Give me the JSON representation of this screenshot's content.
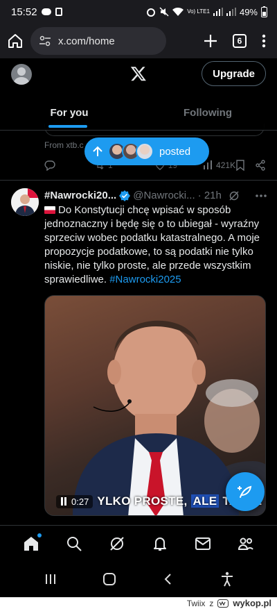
{
  "status_bar": {
    "time": "15:52",
    "signal_label": "Vo) LTE1",
    "battery": "49%"
  },
  "browser": {
    "url": "x.com/home",
    "tab_count": "6"
  },
  "header": {
    "upgrade_label": "Upgrade",
    "tabs": [
      {
        "label": "For you"
      },
      {
        "label": "Following"
      }
    ]
  },
  "previous_post": {
    "from_text": "From xtb.c",
    "reply_count": "",
    "retweet_count": "1",
    "like_count": "19",
    "views_count": "421K"
  },
  "posted_pill": {
    "label": "posted"
  },
  "post": {
    "name": "#Nawrocki20...",
    "handle": "@Nawrocki...",
    "time": "· 21h",
    "text_main": "Do Konstytucji chcę wpisać w sposób jednoznaczny i będę się o to ubiegał - wyraźny sprzeciw wobec podatku katastralnego. A moje propozycje podatkowe, to są podatki nie tylko niskie, nie tylko proste, ale przede wszystkim sprawiedliwe.",
    "hashtag": "#Nawrocki2025",
    "video": {
      "time": "0:27",
      "subtitle_pre": "YLKO PROSTE,",
      "subtitle_hl": "ALE",
      "subtitle_post": "TAKŻE"
    }
  },
  "watermark": {
    "user": "Twiix",
    "connector": "z",
    "site": "wykop.pl"
  },
  "colors": {
    "accent": "#1d9bf0",
    "background": "#000000",
    "border": "#2f3336",
    "muted_text": "#71767b"
  }
}
